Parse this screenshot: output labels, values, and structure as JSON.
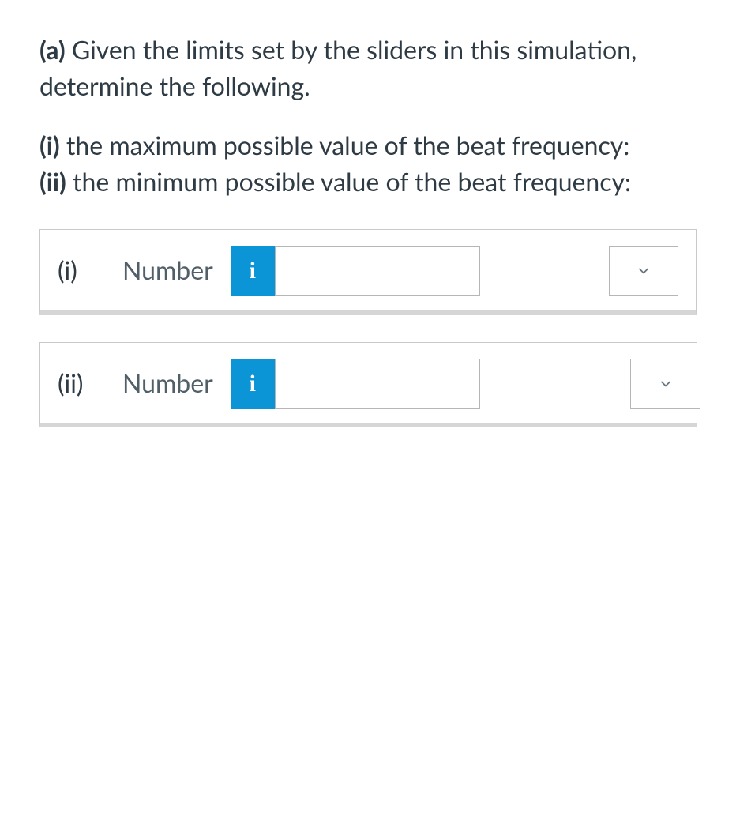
{
  "part_label": "(a)",
  "intro_text": "Given the limits set by the sliders in this simulation, determine the following.",
  "sub_i_label": "(i)",
  "sub_i_text": "the maximum possible value of the beat frequency:",
  "sub_ii_label": "(ii)",
  "sub_ii_text": "the minimum possible value of the beat frequency:",
  "answers": {
    "i": {
      "label": "(i)",
      "word": "Number",
      "info": "i",
      "value": ""
    },
    "ii": {
      "label": "(ii)",
      "word": "Number",
      "info": "i",
      "value": ""
    }
  }
}
